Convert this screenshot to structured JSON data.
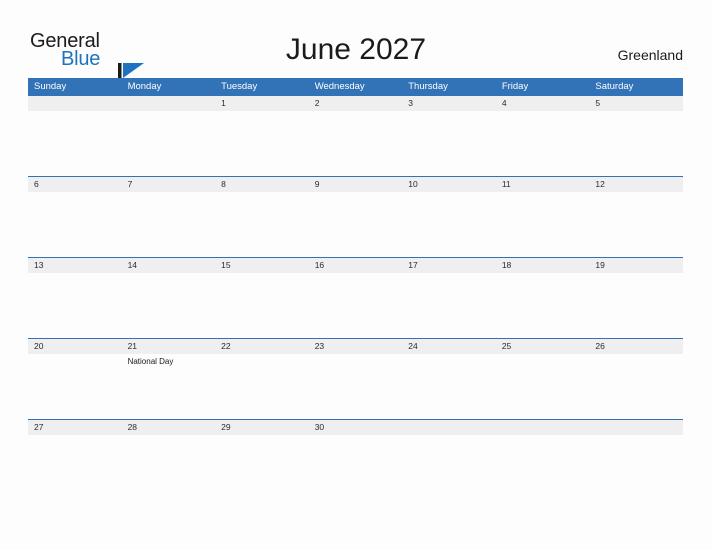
{
  "brand": {
    "name_top": "General",
    "name_bottom": "Blue",
    "flag_icon": "flag-triangle-icon",
    "color_top": "#1b1b1b",
    "color_bottom": "#1f72c0"
  },
  "header": {
    "title": "June 2027",
    "country": "Greenland"
  },
  "colors": {
    "header_blue": "#3272b6",
    "date_band": "#efefef",
    "page_bg": "#fdfdfd",
    "text": "#1b1b1b"
  },
  "calendar": {
    "month": "June",
    "year": "2027",
    "weekday_headers": [
      "Sunday",
      "Monday",
      "Tuesday",
      "Wednesday",
      "Thursday",
      "Friday",
      "Saturday"
    ],
    "weeks": [
      {
        "days": [
          {
            "date": "",
            "events": []
          },
          {
            "date": "",
            "events": []
          },
          {
            "date": "1",
            "events": []
          },
          {
            "date": "2",
            "events": []
          },
          {
            "date": "3",
            "events": []
          },
          {
            "date": "4",
            "events": []
          },
          {
            "date": "5",
            "events": []
          }
        ]
      },
      {
        "days": [
          {
            "date": "6",
            "events": []
          },
          {
            "date": "7",
            "events": []
          },
          {
            "date": "8",
            "events": []
          },
          {
            "date": "9",
            "events": []
          },
          {
            "date": "10",
            "events": []
          },
          {
            "date": "11",
            "events": []
          },
          {
            "date": "12",
            "events": []
          }
        ]
      },
      {
        "days": [
          {
            "date": "13",
            "events": []
          },
          {
            "date": "14",
            "events": []
          },
          {
            "date": "15",
            "events": []
          },
          {
            "date": "16",
            "events": []
          },
          {
            "date": "17",
            "events": []
          },
          {
            "date": "18",
            "events": []
          },
          {
            "date": "19",
            "events": []
          }
        ]
      },
      {
        "days": [
          {
            "date": "20",
            "events": []
          },
          {
            "date": "21",
            "events": [
              "National Day"
            ]
          },
          {
            "date": "22",
            "events": []
          },
          {
            "date": "23",
            "events": []
          },
          {
            "date": "24",
            "events": []
          },
          {
            "date": "25",
            "events": []
          },
          {
            "date": "26",
            "events": []
          }
        ]
      },
      {
        "days": [
          {
            "date": "27",
            "events": []
          },
          {
            "date": "28",
            "events": []
          },
          {
            "date": "29",
            "events": []
          },
          {
            "date": "30",
            "events": []
          },
          {
            "date": "",
            "events": []
          },
          {
            "date": "",
            "events": []
          },
          {
            "date": "",
            "events": []
          }
        ]
      }
    ]
  }
}
